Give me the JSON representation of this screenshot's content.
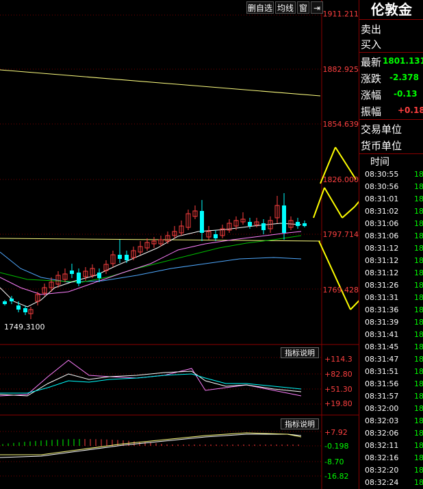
{
  "toolbar": {
    "buttons": [
      "删自选",
      "均线",
      "窗"
    ],
    "next_icon": "next-page-icon"
  },
  "price_axis": [
    "1911.211",
    "1882.925",
    "1854.639",
    "1826.000",
    "1797.714",
    "1769.428"
  ],
  "low_label": "1749.3100",
  "indicator1": {
    "button": "指标说明",
    "ticks": [
      "+114.3",
      "+82.80",
      "+51.30",
      "+19.80"
    ]
  },
  "indicator2": {
    "button": "指标说明",
    "ticks": [
      "+7.92",
      "-0.198",
      "-8.70",
      "-16.82"
    ]
  },
  "sidebar": {
    "title": "伦敦金",
    "sell": "卖出",
    "buy": "买入",
    "latest_label": "最新",
    "latest_value": "1801.131",
    "change_label": "涨跌",
    "change_value": "-2.378",
    "changepct_label": "涨幅",
    "changepct_value": "-0.13",
    "amplitude_label": "振幅",
    "amplitude_value": "+0.18",
    "unit_label": "交易单位",
    "currency_label": "货币单位",
    "time_header": "时间",
    "times": [
      "08:30:55",
      "08:30:56",
      "08:31:01",
      "08:31:02",
      "08:31:06",
      "08:31:06",
      "08:31:12",
      "08:31:12",
      "08:31:12",
      "08:31:26",
      "08:31:31",
      "08:31:36",
      "08:31:39",
      "08:31:41",
      "08:31:45",
      "08:31:47",
      "08:31:51",
      "08:31:56",
      "08:31:57",
      "08:32:00",
      "08:32:03",
      "08:32:06",
      "08:32:11",
      "08:32:16",
      "08:32:20",
      "08:32:24"
    ],
    "tick_value": "18"
  },
  "colors": {
    "up": "#ff4040",
    "down": "#00ffff",
    "ma_yellow": "#ffff80",
    "ma_purple": "#ff80ff",
    "ma_green": "#00c000",
    "ma_blue": "#4fa9ff",
    "arrow": "#ffff00"
  }
}
